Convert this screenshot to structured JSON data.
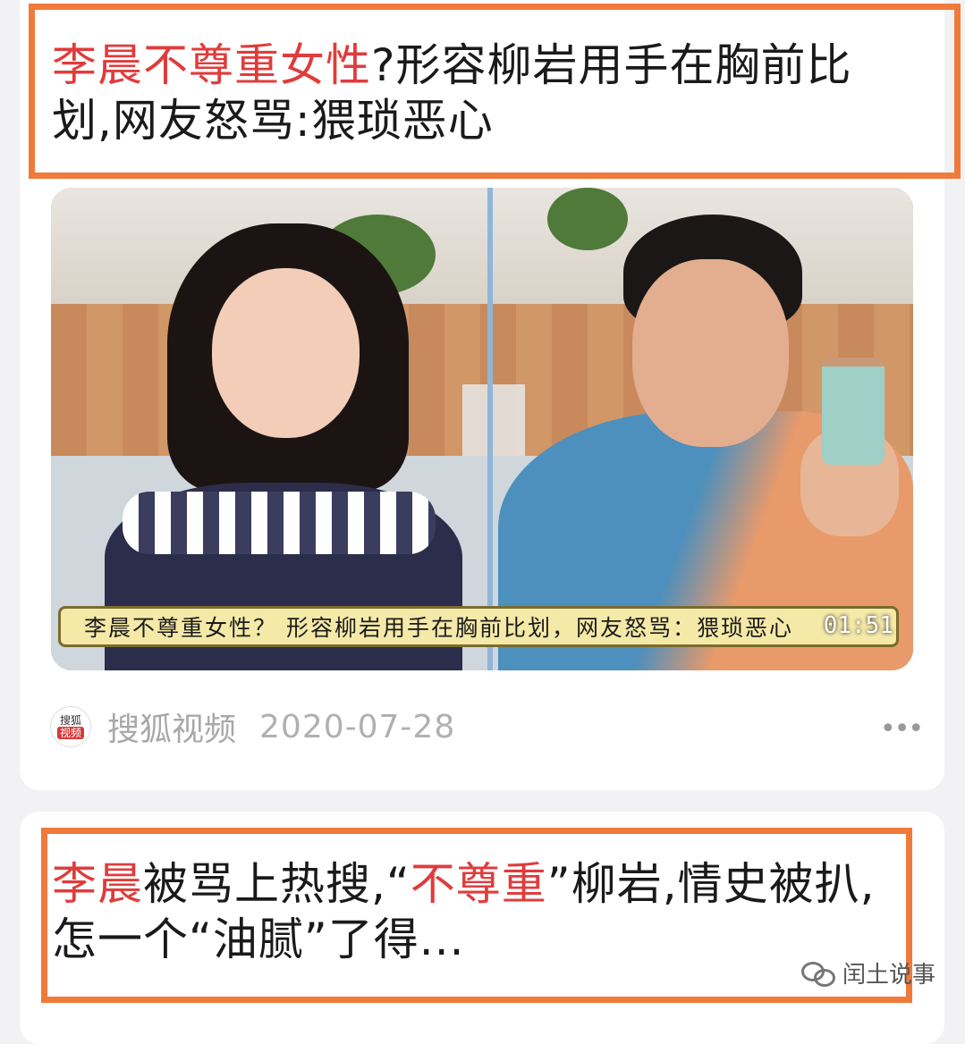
{
  "articles": [
    {
      "title_highlight": "李晨不尊重女性",
      "title_rest": "?形容柳岩用手在胸前比划,网友怒骂:猥琐恶心",
      "video": {
        "subtitle": "李晨不尊重女性？ 形容柳岩用手在胸前比划，网友怒骂：猥琐恶心",
        "duration": "01:51"
      },
      "source": {
        "logo_top": "搜狐",
        "logo_bottom": "视频",
        "name": "搜狐视频",
        "date": "2020-07-28"
      },
      "more_icon": "more-dots-icon"
    },
    {
      "title_part1": "李晨",
      "title_part2": "被骂上热搜,“",
      "title_part3": "不尊重",
      "title_part4": "”柳岩,情史被扒,怎一个“油腻”了得..."
    }
  ],
  "watermark": {
    "icon": "wechat-icon",
    "text": "闰土说事"
  },
  "colors": {
    "highlight": "#e03c3c",
    "frame": "#f07a3a",
    "background": "#f2f2f4"
  }
}
